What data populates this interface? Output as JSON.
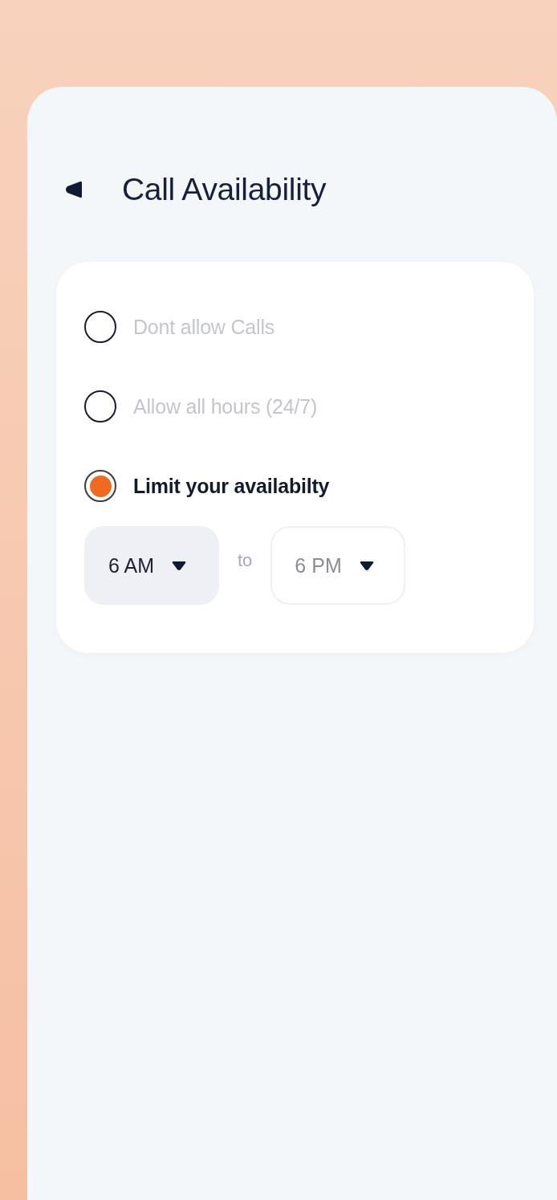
{
  "screen": {
    "title": "Call Availability"
  },
  "options": [
    {
      "label": "Dont allow Calls",
      "selected": false
    },
    {
      "label": "Allow all hours (24/7)",
      "selected": false
    },
    {
      "label": "Limit your availabilty",
      "selected": true
    }
  ],
  "time_range": {
    "from": {
      "value": "6 AM",
      "selected": true
    },
    "separator": "to",
    "to": {
      "value": "6 PM",
      "selected": false
    }
  }
}
